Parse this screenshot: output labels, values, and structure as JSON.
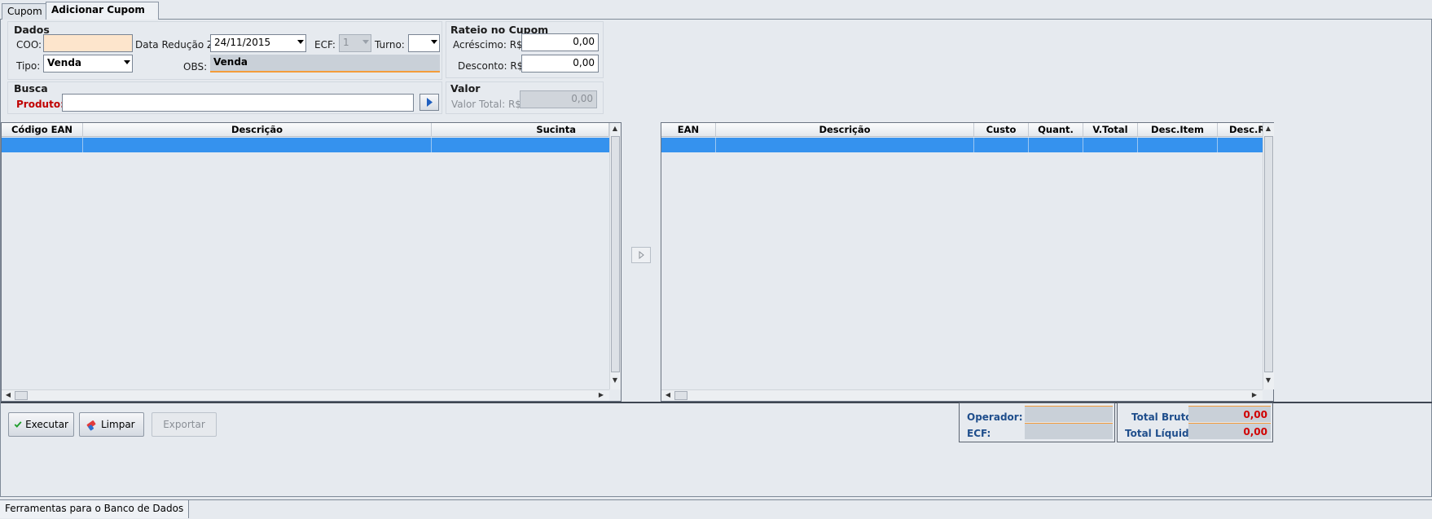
{
  "tabs": [
    "Cupom",
    "Adicionar Cupom"
  ],
  "dados": {
    "title": "Dados",
    "coo_label": "COO:",
    "coo_value": "",
    "data_reducao_label": "Data Redução Z:",
    "data_reducao_value": "24/11/2015",
    "ecf_label": "ECF:",
    "ecf_value": "1",
    "turno_label": "Turno:",
    "turno_value": "",
    "tipo_label": "Tipo:",
    "tipo_value": "Venda",
    "obs_label": "OBS:",
    "obs_value": "Venda"
  },
  "rateio": {
    "title": "Rateio no Cupom",
    "acrescimo_label": "Acréscimo: R$",
    "acrescimo_value": "0,00",
    "desconto_label": "Desconto: R$",
    "desconto_value": "0,00"
  },
  "busca": {
    "title": "Busca",
    "produto_label": "Produto:",
    "produto_value": ""
  },
  "valor": {
    "title": "Valor",
    "valor_total_label": "Valor Total: R$",
    "valor_total_value": "0,00"
  },
  "left_grid": {
    "columns": [
      "Código EAN",
      "Descrição",
      "Sucinta"
    ]
  },
  "right_grid": {
    "columns": [
      "EAN",
      "Descrição",
      "Custo",
      "Quant.",
      "V.Total",
      "Desc.Item",
      "Desc.Ra"
    ]
  },
  "buttons": {
    "executar": "Executar",
    "limpar": "Limpar",
    "exportar": "Exportar"
  },
  "operator_panel": {
    "operador_label": "Operador:",
    "operador_value": "",
    "ecf_label": "ECF:",
    "ecf_value": ""
  },
  "totals_panel": {
    "total_bruto_label": "Total Bruto:",
    "total_bruto_value": "0,00",
    "total_liquido_label": "Total Líquido:",
    "total_liquido_value": "0,00"
  },
  "status_bar": {
    "label": "Ferramentas para o Banco de Dados"
  },
  "colors": {
    "selection": "#3592ee",
    "coo_bg": "#fde5cc",
    "accent_orange": "#f39c3b",
    "total_red": "#d00000",
    "label_blue": "#1f4e8c"
  }
}
